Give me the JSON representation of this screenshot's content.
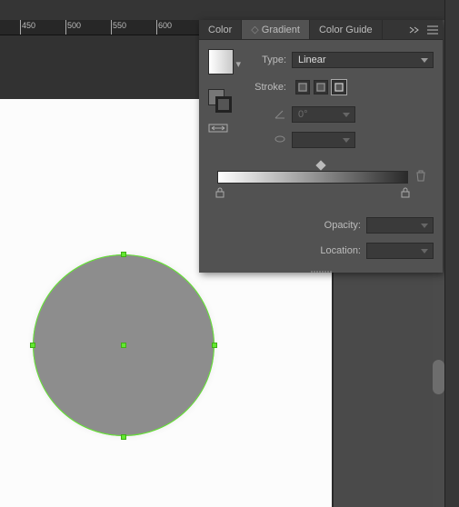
{
  "ruler": {
    "marks": [
      450,
      500,
      550,
      600
    ]
  },
  "panel": {
    "tabs": {
      "color": "Color",
      "gradient": "Gradient",
      "guide": "Color Guide"
    },
    "type_label": "Type:",
    "type_value": "Linear",
    "stroke_label": "Stroke:",
    "angle_label": "",
    "angle_value": "0°",
    "aspect_value": "",
    "opacity_label": "Opacity:",
    "opacity_value": "",
    "location_label": "Location:",
    "location_value": ""
  }
}
